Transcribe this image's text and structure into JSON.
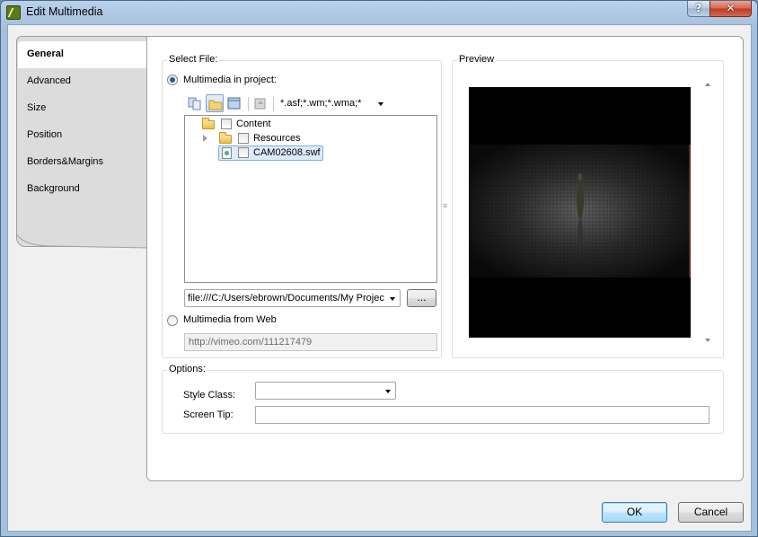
{
  "window": {
    "title": "Edit Multimedia",
    "help_glyph": "?",
    "close_glyph": "✕"
  },
  "tabs": [
    {
      "label": "General",
      "active": true
    },
    {
      "label": "Advanced",
      "active": false
    },
    {
      "label": "Size",
      "active": false
    },
    {
      "label": "Position",
      "active": false
    },
    {
      "label": "Borders&Margins",
      "active": false
    },
    {
      "label": "Background",
      "active": false
    }
  ],
  "select_file": {
    "legend": "Select File:",
    "radio_project": {
      "label": "Multimedia in project:",
      "checked": true
    },
    "filter": "*.asf;*.wm;*.wma;*",
    "tree": [
      {
        "label": "Content",
        "expandable": false,
        "checked": false
      },
      {
        "label": "Resources",
        "expandable": true,
        "checked": false
      },
      {
        "label": "CAM02608.swf",
        "expandable": false,
        "checked": false,
        "selected": true
      }
    ],
    "path_value": "file:///C:/Users/ebrown/Documents/My Projec",
    "browse_label": "...",
    "radio_web": {
      "label": "Multimedia from Web",
      "checked": false
    },
    "web_url_placeholder": "http://vimeo.com/111217479"
  },
  "preview": {
    "legend": "Preview",
    "splitter_glyph": "≡"
  },
  "options": {
    "legend": "Options:",
    "style_class_label": "Style Class:",
    "style_class_value": "",
    "screen_tip_label": "Screen Tip:",
    "screen_tip_value": ""
  },
  "footer": {
    "ok_label": "OK",
    "cancel_label": "Cancel"
  },
  "colors": {
    "accent": "#3c7fb1",
    "selection": "#dcebfc",
    "titlebar": "#b9d1ea"
  }
}
